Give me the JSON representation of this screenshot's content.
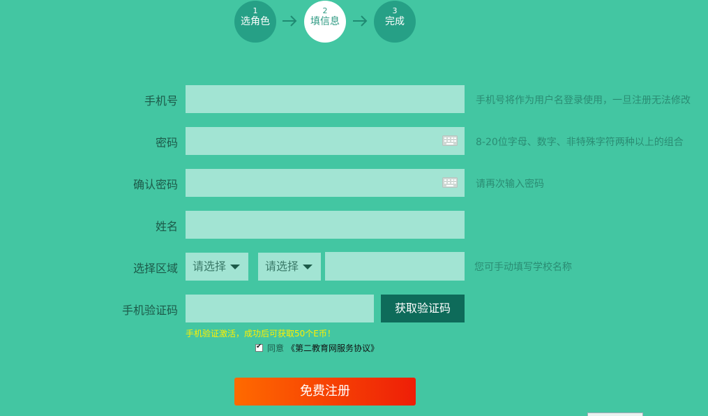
{
  "steps": [
    {
      "num": "1",
      "label": "选角色"
    },
    {
      "num": "2",
      "label": "填信息"
    },
    {
      "num": "3",
      "label": "完成"
    }
  ],
  "form": {
    "phone": {
      "label": "手机号",
      "hint": "手机号将作为用户名登录使用，一旦注册无法修改"
    },
    "password": {
      "label": "密码",
      "hint": "8-20位字母、数字、非特殊字符两种以上的组合"
    },
    "confirm_password": {
      "label": "确认密码",
      "hint": "请再次输入密码"
    },
    "name": {
      "label": "姓名"
    },
    "region": {
      "label": "选择区域",
      "select1": "请选择",
      "select2": "请选择",
      "hint": "您可手动填写学校名称"
    },
    "sms": {
      "label": "手机验证码",
      "button": "获取验证码",
      "note": "手机验证激活，成功后可获取50个E币！"
    },
    "agree": {
      "text": "同意",
      "link": "《第二教育网服务协议》",
      "checked": true
    },
    "submit": "免费注册"
  },
  "colors": {
    "background": "#43c6a2",
    "field": "#a2e4d3",
    "button_dark": "#0e6b5a",
    "submit": "#ff6a00"
  }
}
